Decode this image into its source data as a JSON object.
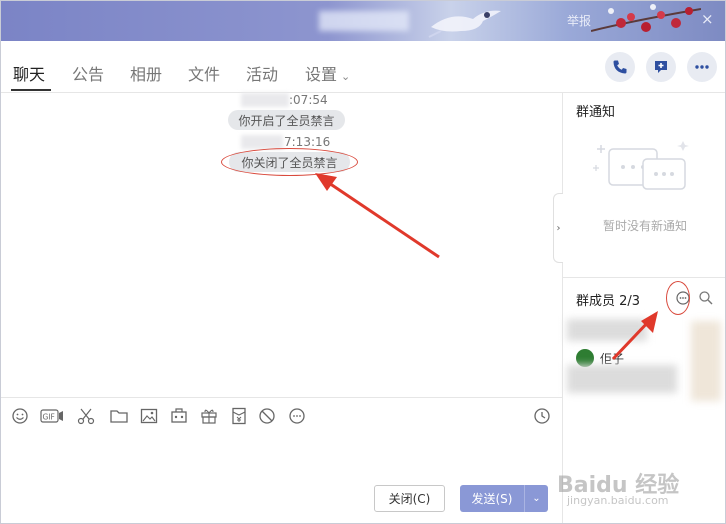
{
  "header": {
    "report_label": "举报",
    "close_glyph": "×"
  },
  "tabs": [
    {
      "label": "聊天"
    },
    {
      "label": "公告"
    },
    {
      "label": "相册"
    },
    {
      "label": "文件"
    },
    {
      "label": "活动"
    },
    {
      "label": "设置"
    }
  ],
  "header_buttons": [
    {
      "icon": "phone-icon"
    },
    {
      "icon": "add-chat-icon"
    },
    {
      "icon": "more-icon"
    }
  ],
  "chat": {
    "messages": [
      {
        "time": ":07:54",
        "text": "你开启了全员禁言"
      },
      {
        "time": "7:13:16",
        "text": "你关闭了全员禁言"
      }
    ]
  },
  "toolbar": {
    "tools": [
      "emoji-icon",
      "gif-icon",
      "scissors-icon",
      "folder-icon",
      "image-icon",
      "screenshot-icon",
      "gift-icon",
      "red-packet-icon",
      "block-icon",
      "more-icon"
    ],
    "history_icon": "clock-icon"
  },
  "actions": {
    "close_label": "关闭(C)",
    "send_label": "发送(S)"
  },
  "side": {
    "notice_title": "群通知",
    "notice_empty": "暂时没有新通知",
    "members_title": "群成员 2/3",
    "member_name": "佢子"
  },
  "watermark": {
    "brand": "Baidu 经验",
    "url": "jingyan.baidu.com"
  },
  "colors": {
    "accent": "#8a98d6",
    "annotation_red": "#d94a3d",
    "banner": "#7b84c6"
  }
}
